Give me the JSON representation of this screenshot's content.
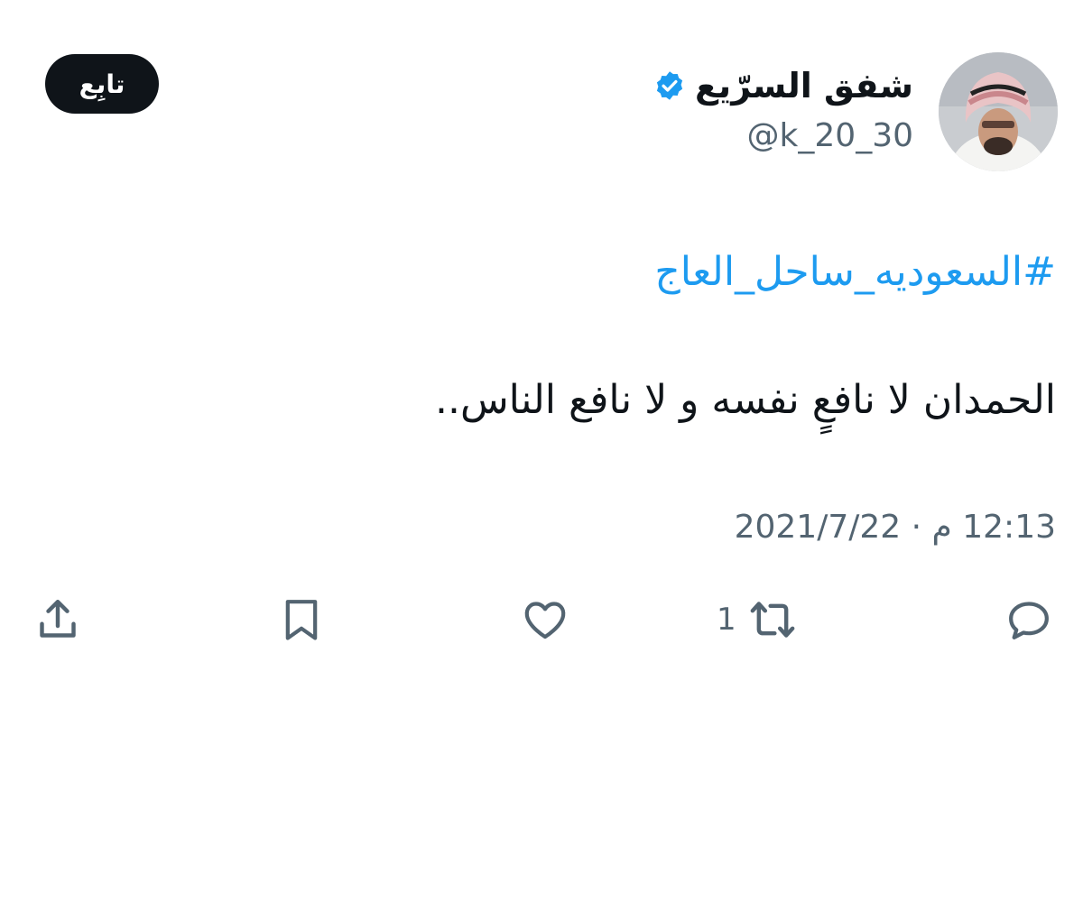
{
  "author": {
    "display_name": "شفق السرّيع",
    "handle": "@k_20_30",
    "verified_icon": "verified-badge-icon",
    "avatar": "profile-photo"
  },
  "follow_button": {
    "label": "تابِع"
  },
  "tweet": {
    "hashtag": "#السعوديه_ساحل_العاج",
    "text": "الحمدان لا نافعٍ نفسه و لا نافع الناس..",
    "timestamp": "12:13 م · 2021/7/22"
  },
  "actions": {
    "reply_icon": "reply-icon",
    "retweet_icon": "retweet-icon",
    "retweet_count": "1",
    "like_icon": "heart-icon",
    "bookmark_icon": "bookmark-icon",
    "share_icon": "share-icon"
  },
  "colors": {
    "accent": "#1d9bf0",
    "text_primary": "#0f1419",
    "text_secondary": "#536471",
    "button_bg": "#0f1419"
  }
}
